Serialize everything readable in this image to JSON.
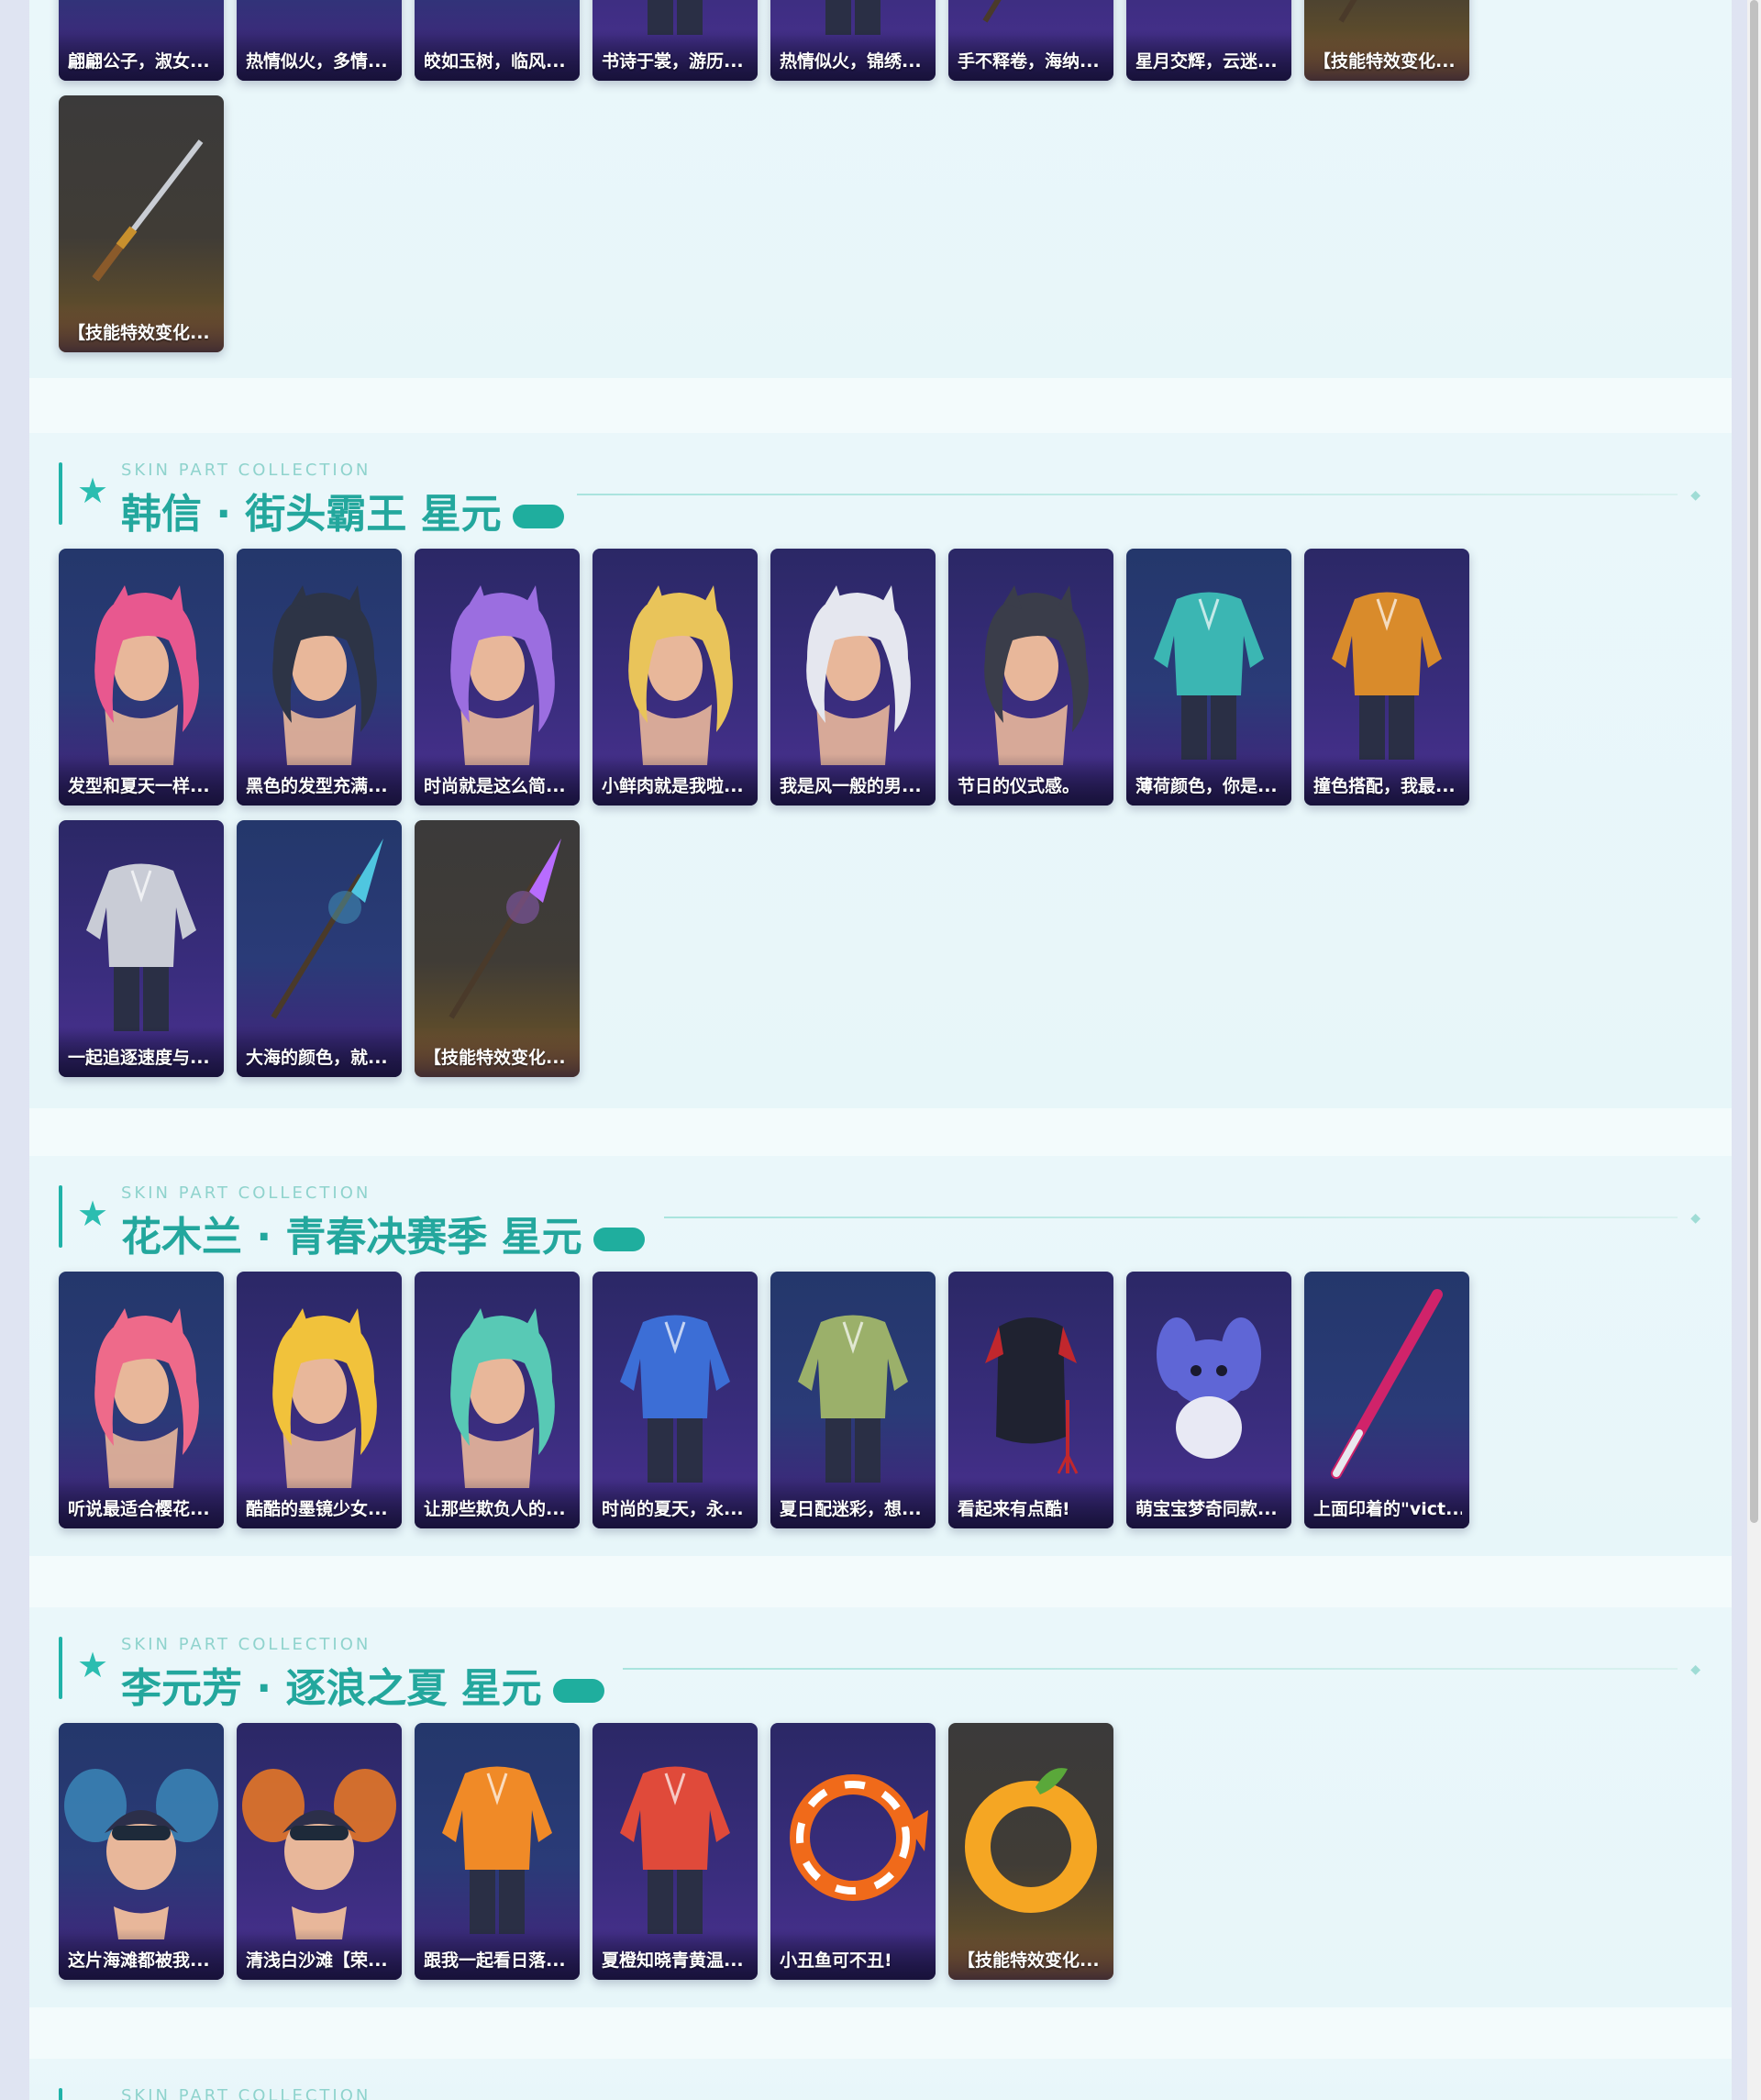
{
  "top_section": {
    "cards": [
      {
        "label": "翩翩公子，淑女...",
        "theme": "blue",
        "icon": "head-icon"
      },
      {
        "label": "热情似火，多情...",
        "theme": "blue",
        "icon": "head-icon"
      },
      {
        "label": "皎如玉树，临风...",
        "theme": "blue",
        "icon": "head-icon"
      },
      {
        "label": "书诗于裳，游历...",
        "theme": "purple",
        "icon": "outfit-icon"
      },
      {
        "label": "热情似火，锦绣...",
        "theme": "purple",
        "icon": "outfit-icon"
      },
      {
        "label": "手不释卷，海纳...",
        "theme": "purple",
        "icon": "weapon-icon"
      },
      {
        "label": "星月交辉，云迷...",
        "theme": "purple",
        "icon": "accessory-icon"
      },
      {
        "label": "【技能特效变化...",
        "theme": "gold",
        "icon": "weapon-icon"
      },
      {
        "label": "【技能特效变化...",
        "theme": "gold",
        "icon": "sword-icon"
      }
    ]
  },
  "sections": [
    {
      "subtitle": "SKIN PART COLLECTION",
      "title": "韩信 · 街头霸王 星元",
      "cards": [
        {
          "label": "发型和夏天一样...",
          "theme": "blue",
          "icon": "hair-head-icon",
          "hair": "#e8588f"
        },
        {
          "label": "黑色的发型充满...",
          "theme": "blue",
          "icon": "hair-head-icon",
          "hair": "#2d3446"
        },
        {
          "label": "时尚就是这么简...",
          "theme": "purple",
          "icon": "hair-head-icon",
          "hair": "#9b6ee0"
        },
        {
          "label": "小鲜肉就是我啦...",
          "theme": "purple",
          "icon": "hair-head-icon",
          "hair": "#e9c45a"
        },
        {
          "label": "我是风一般的男...",
          "theme": "purple",
          "icon": "hair-head-icon",
          "hair": "#e5e7ef"
        },
        {
          "label": "节日的仪式感。",
          "theme": "purple",
          "icon": "hair-head-icon",
          "hair": "#3a3d4a"
        },
        {
          "label": "薄荷颜色，你是...",
          "theme": "blue",
          "icon": "jacket-icon",
          "hair": "#3bb6b3"
        },
        {
          "label": "撞色搭配，我最...",
          "theme": "purple",
          "icon": "jacket-icon",
          "hair": "#d98b2b"
        },
        {
          "label": "一起追逐速度与...",
          "theme": "purple",
          "icon": "jacket-icon",
          "hair": "#c9ccd6"
        },
        {
          "label": "大海的颜色，就...",
          "theme": "blue",
          "icon": "spear-icon",
          "hair": "#4fc6e0"
        },
        {
          "label": "【技能特效变化...",
          "theme": "gold",
          "icon": "spear-icon",
          "hair": "#b86cff"
        }
      ]
    },
    {
      "subtitle": "SKIN PART COLLECTION",
      "title": "花木兰 · 青春决赛季 星元",
      "cards": [
        {
          "label": "听说最适合樱花...",
          "theme": "blue",
          "icon": "hair-head-icon",
          "hair": "#ee6a8a"
        },
        {
          "label": "酷酷的墨镜少女...",
          "theme": "purple",
          "icon": "hair-head-icon",
          "hair": "#f1c23b"
        },
        {
          "label": "让那些欺负人的...",
          "theme": "purple",
          "icon": "hair-head-icon",
          "hair": "#58c9b5"
        },
        {
          "label": "时尚的夏天，永...",
          "theme": "purple",
          "icon": "outfit-icon",
          "hair": "#3c6ed6"
        },
        {
          "label": "夏日配迷彩，想...",
          "theme": "blue",
          "icon": "outfit-icon",
          "hair": "#9bb06a"
        },
        {
          "label": "看起来有点酷!",
          "theme": "purple",
          "icon": "backpack-icon",
          "hair": "#c1272d"
        },
        {
          "label": "萌宝宝梦奇同款...",
          "theme": "purple",
          "icon": "plush-icon",
          "hair": "#5f66d6"
        },
        {
          "label": "上面印着的\"vict...",
          "theme": "blue",
          "icon": "bat-icon",
          "hair": "#d0236a"
        }
      ]
    },
    {
      "subtitle": "SKIN PART COLLECTION",
      "title": "李元芳 · 逐浪之夏 星元",
      "cards": [
        {
          "label": "这片海滩都被我...",
          "theme": "blue",
          "icon": "hat-head-icon",
          "hair": "#3b86b7"
        },
        {
          "label": "清浅白沙滩【荣...",
          "theme": "purple",
          "icon": "hat-head-icon",
          "hair": "#ef7a22"
        },
        {
          "label": "跟我一起看日落...",
          "theme": "blue",
          "icon": "outfit-icon",
          "hair": "#f08a27"
        },
        {
          "label": "夏橙知晓青黄温...",
          "theme": "purple",
          "icon": "outfit-icon",
          "hair": "#e04a3a"
        },
        {
          "label": "小丑鱼可不丑!",
          "theme": "purple",
          "icon": "fish-icon",
          "hair": "#f06a1a"
        },
        {
          "label": "【技能特效变化...",
          "theme": "gold",
          "icon": "orange-ring-icon",
          "hair": "#f5a623"
        }
      ]
    },
    {
      "subtitle": "SKIN PART COLLECTION",
      "title": "",
      "cards": []
    }
  ]
}
